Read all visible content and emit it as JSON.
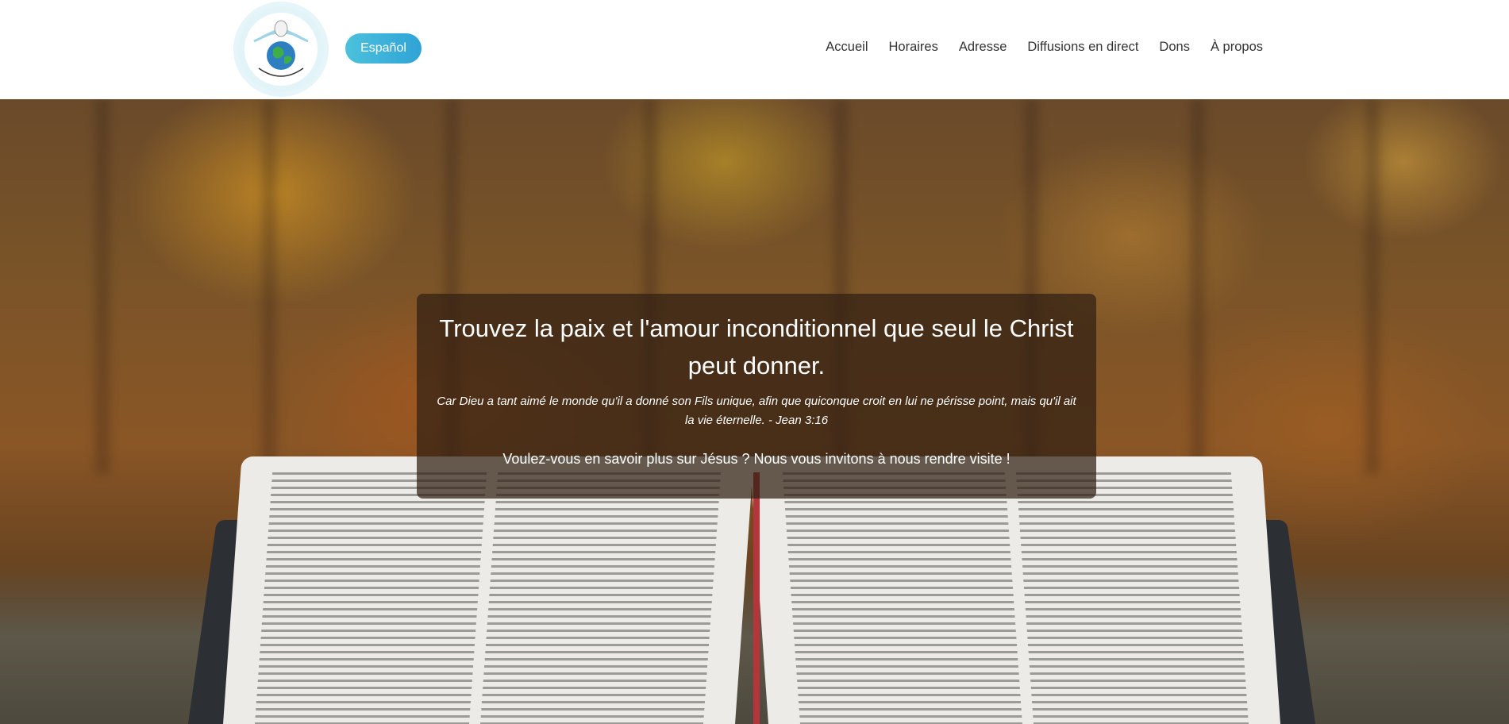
{
  "header": {
    "logo_alt": "ÉGLISE LE RESTE DE SA GRÂCE",
    "language_button": "Español",
    "nav": [
      {
        "label": "Accueil"
      },
      {
        "label": "Horaires"
      },
      {
        "label": "Adresse"
      },
      {
        "label": "Diffusions en direct"
      },
      {
        "label": "Dons"
      },
      {
        "label": "À propos"
      }
    ]
  },
  "hero": {
    "title": "Trouvez la paix et l'amour inconditionnel que seul le Christ peut donner.",
    "verse": "Car Dieu a tant aimé le monde qu'il a donné son Fils unique, afin que quiconque croit en lui ne périsse point, mais qu'il ait la vie éternelle. - Jean 3:16",
    "invitation": "Voulez-vous en savoir plus sur Jésus ? Nous vous invitons à nous rendre visite !"
  },
  "colors": {
    "brand_button": "#2fa3d6",
    "overlay": "#30201400",
    "nav_text": "#333333"
  }
}
